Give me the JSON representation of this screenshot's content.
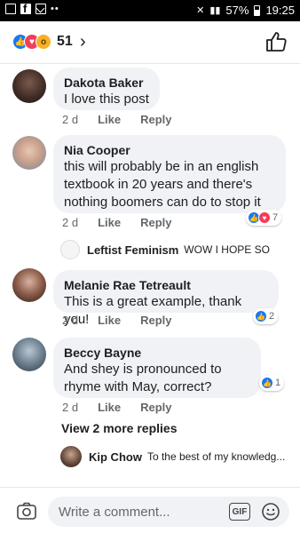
{
  "status_bar": {
    "battery": "57%",
    "time": "19:25"
  },
  "header": {
    "reaction_count": "51"
  },
  "comments": [
    {
      "author": "Dakota Baker",
      "text": "I love this post",
      "time": "2 d",
      "like_label": "Like",
      "reply_label": "Reply"
    },
    {
      "author": "Nia Cooper",
      "text": "this will probably be in an english textbook in 20 years and there's nothing boomers can do to stop it",
      "time": "2 d",
      "like_label": "Like",
      "reply_label": "Reply",
      "reaction_count": "7",
      "reply_preview": {
        "author": "Leftist Feminism",
        "text": "WOW I HOPE SO"
      }
    },
    {
      "author": "Melanie Rae Tetreault",
      "text": "This is a great example, thank you!",
      "time": "2 d",
      "like_label": "Like",
      "reply_label": "Reply",
      "reaction_count": "2"
    },
    {
      "author": "Beccy Bayne",
      "text": "And shey is pronounced to rhyme with May, correct?",
      "time": "2 d",
      "like_label": "Like",
      "reply_label": "Reply",
      "reaction_count": "1",
      "view_more": "View 2 more replies",
      "reply_preview": {
        "author": "Kip Chow",
        "text": "To the best of my knowledg..."
      }
    }
  ],
  "composer": {
    "placeholder": "Write a comment...",
    "gif_label": "GIF"
  },
  "colors": {
    "like_blue": "#1877f2",
    "love_red": "#f33e58",
    "wow_yellow": "#f7b125",
    "bubble_grey": "#f0f2f5",
    "meta_grey": "#65676b"
  }
}
